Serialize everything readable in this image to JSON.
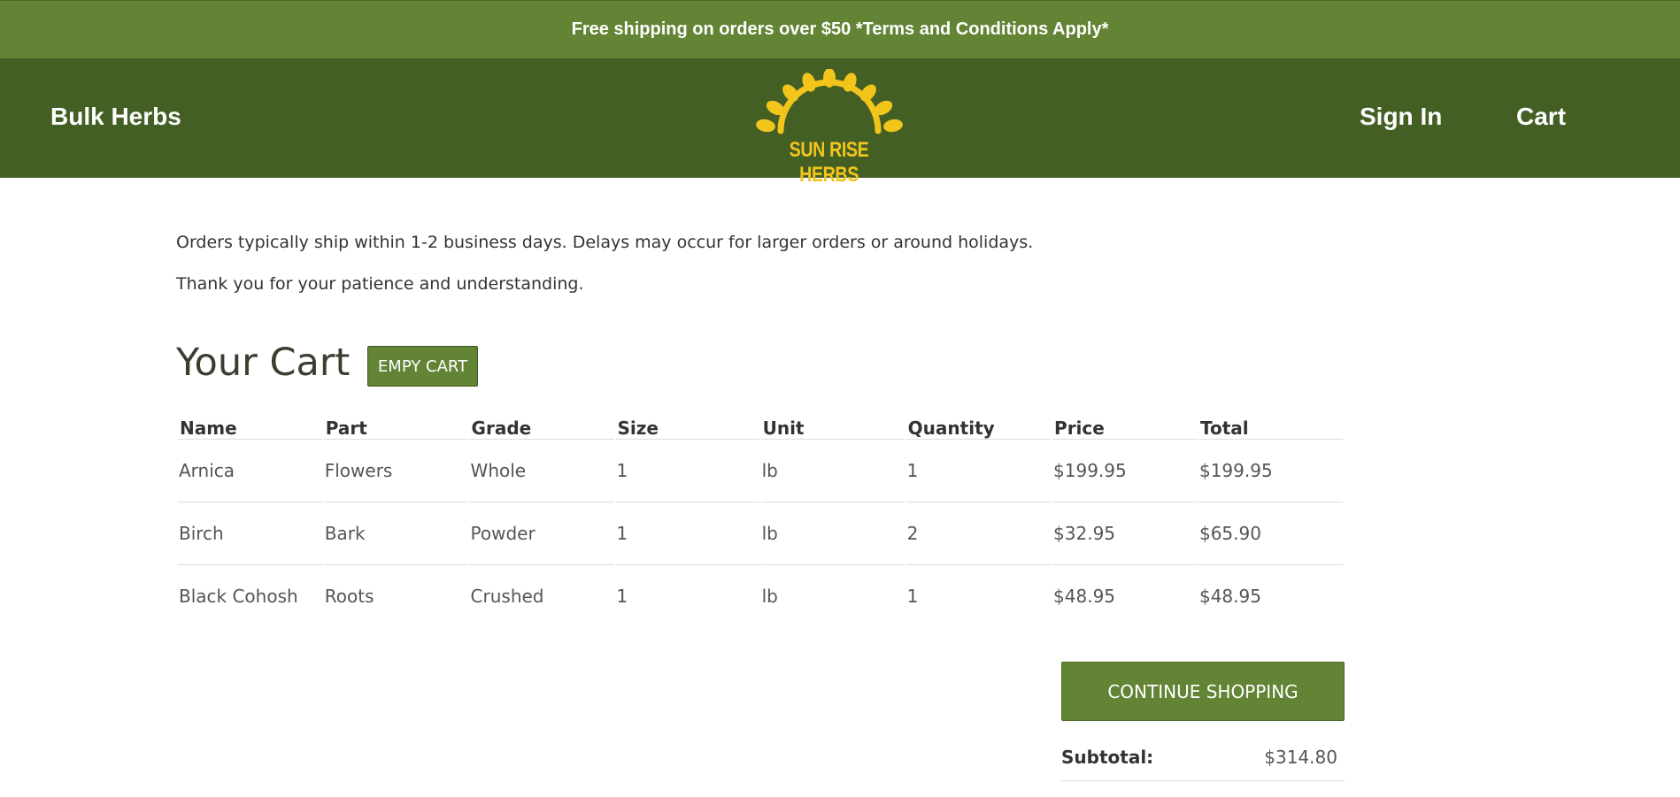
{
  "banner": {
    "text": "Free shipping on orders over $50 *Terms and Conditions Apply*"
  },
  "nav": {
    "left_link": "Bulk Herbs",
    "sign_in": "Sign In",
    "cart": "Cart",
    "logo_text": "SUN RISE HERBS",
    "logo_icon": "sunrise-leaves-logo"
  },
  "notice": {
    "line1": "Orders typically ship within 1-2 business days. Delays may occur for larger orders or around holidays.",
    "line2": "Thank you for your patience and understanding."
  },
  "cart": {
    "title": "Your Cart",
    "empty_label": "EMPY CART",
    "columns": [
      "Name",
      "Part",
      "Grade",
      "Size",
      "Unit",
      "Quantity",
      "Price",
      "Total"
    ],
    "rows": [
      [
        "Arnica",
        "Flowers",
        "Whole",
        "1",
        "lb",
        "1",
        "$199.95",
        "$199.95"
      ],
      [
        "Birch",
        "Bark",
        "Powder",
        "1",
        "lb",
        "2",
        "$32.95",
        "$65.90"
      ],
      [
        "Black Cohosh",
        "Roots",
        "Crushed",
        "1",
        "lb",
        "1",
        "$48.95",
        "$48.95"
      ]
    ],
    "continue_label": "CONTINUE SHOPPING",
    "subtotal_label": "Subtotal:",
    "subtotal_value": "$314.80"
  },
  "colors": {
    "banner": "#628434",
    "nav": "#445f24",
    "button": "#628434",
    "logo": "#f2c51b"
  }
}
